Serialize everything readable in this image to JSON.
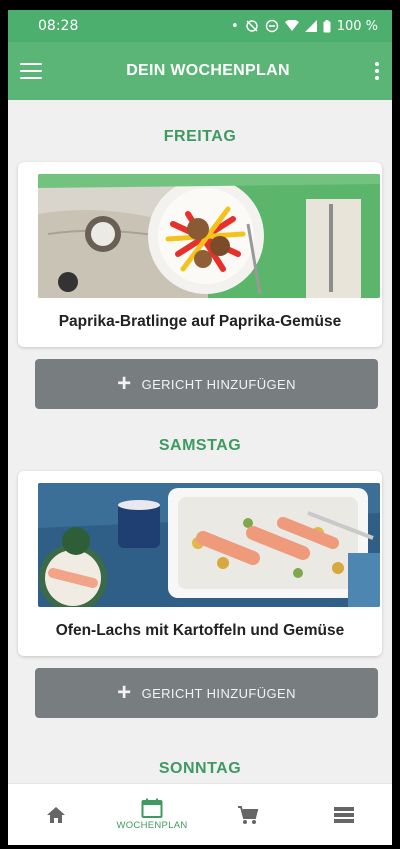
{
  "status_bar": {
    "time": "08:28",
    "dot": "•",
    "battery_percent": "100 %"
  },
  "app_bar": {
    "title": "DEIN WOCHENPLAN",
    "menu_icon": "hamburger-menu-icon",
    "overflow_icon": "more-vertical-icon"
  },
  "days": [
    {
      "name": "FREITAG",
      "meal": "Paprika-Bratlinge auf Paprika-Gemüse",
      "add_label": "GERICHT HINZUFÜGEN"
    },
    {
      "name": "SAMSTAG",
      "meal": "Ofen-Lachs mit Kartoffeln und Gemüse",
      "add_label": "GERICHT HINZUFÜGEN"
    },
    {
      "name": "SONNTAG"
    }
  ],
  "bottom_nav": {
    "items": [
      {
        "icon": "home-icon",
        "label": ""
      },
      {
        "icon": "calendar-icon",
        "label": "WOCHENPLAN"
      },
      {
        "icon": "cart-icon",
        "label": ""
      },
      {
        "icon": "list-icon",
        "label": ""
      }
    ],
    "active_index": 1
  },
  "colors": {
    "primary": "#5ab577",
    "status_bar": "#4caf6e",
    "day_heading": "#3f9a62",
    "add_button": "#787d80",
    "background": "#f0f0f0"
  }
}
